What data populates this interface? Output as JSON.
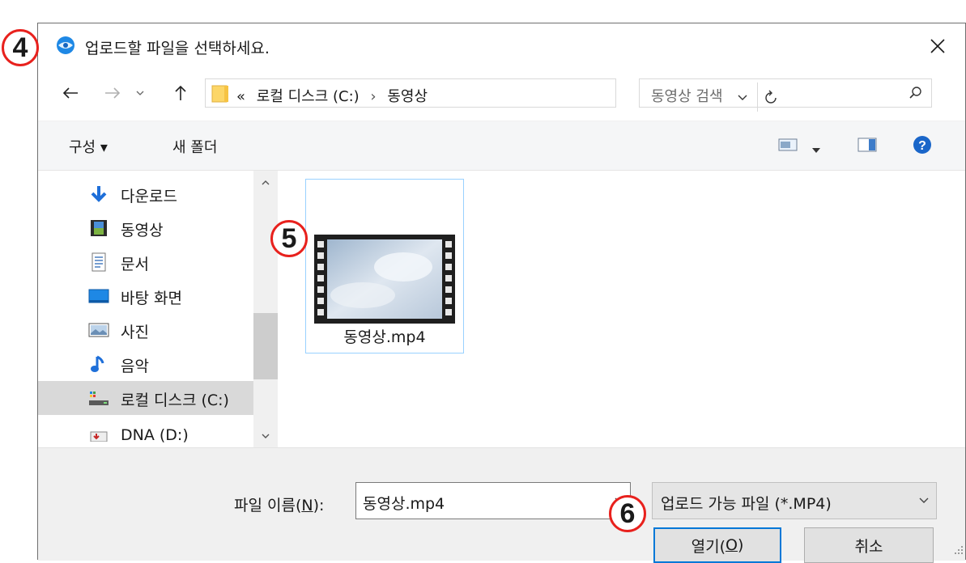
{
  "callouts": [
    "4",
    "5",
    "6"
  ],
  "dialog": {
    "title": "업로드할 파일을 선택하세요.",
    "address": {
      "overflow": "«",
      "crumbs": [
        "로컬 디스크 (C:)",
        "동영상"
      ],
      "separator": "›"
    },
    "search_placeholder": "동영상 검색",
    "toolbar": {
      "organize": "구성 ▾",
      "new_folder": "새 폴더"
    },
    "nav_items": [
      {
        "label": "다운로드",
        "icon": "download-icon"
      },
      {
        "label": "동영상",
        "icon": "video-folder-icon"
      },
      {
        "label": "문서",
        "icon": "document-icon"
      },
      {
        "label": "바탕 화면",
        "icon": "desktop-icon"
      },
      {
        "label": "사진",
        "icon": "pictures-icon"
      },
      {
        "label": "음악",
        "icon": "music-icon"
      },
      {
        "label": "로컬 디스크 (C:)",
        "icon": "drive-icon",
        "selected": true
      },
      {
        "label": "DNA (D:)",
        "icon": "drive-icon"
      }
    ],
    "files": [
      {
        "name": "동영상.mp4",
        "icon": "video-thumbnail"
      }
    ],
    "filename_label": "파일 이름(",
    "filename_label_key": "N",
    "filename_label_end": "):",
    "filename_value": "동영상.mp4",
    "filetype": "업로드 가능 파일 (*.MP4)",
    "open_label": "열기(",
    "open_key": "O",
    "open_end": ")",
    "cancel_label": "취소"
  },
  "colors": {
    "callout": "#e8211d",
    "accent": "#0078d7",
    "selection": "#99d1ff"
  }
}
